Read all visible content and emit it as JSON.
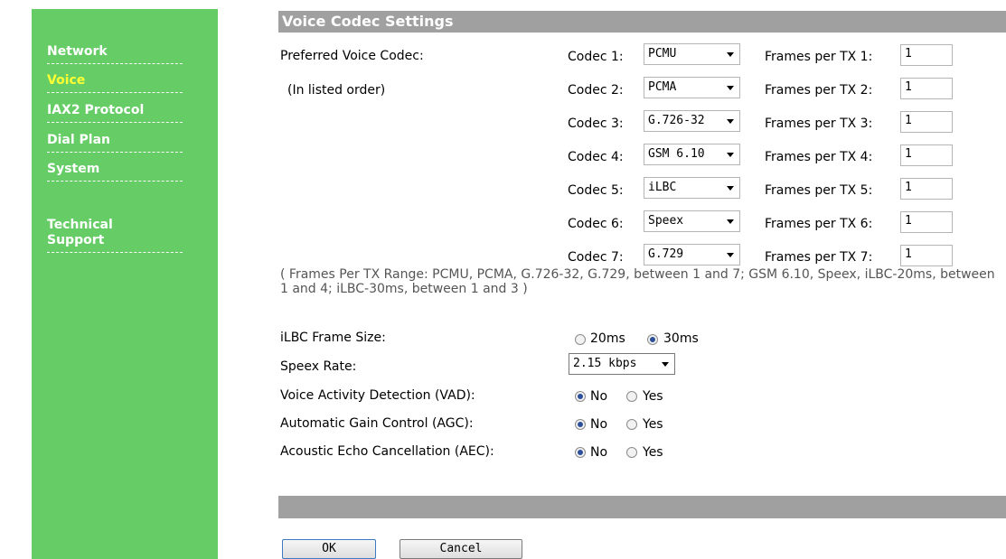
{
  "nav": {
    "items": [
      {
        "label": "Network"
      },
      {
        "label": "Voice"
      },
      {
        "label": "IAX2 Protocol"
      },
      {
        "label": "Dial Plan"
      },
      {
        "label": "System"
      }
    ],
    "support_line1": "Technical",
    "support_line2": "Support"
  },
  "section": {
    "title": "Voice Codec Settings"
  },
  "preferred": {
    "label": "Preferred Voice Codec:",
    "order_note": "(In listed order)"
  },
  "codecs": [
    {
      "label": "Codec 1:",
      "value": "PCMU",
      "frames_label": "Frames per TX 1:",
      "frames": "1"
    },
    {
      "label": "Codec 2:",
      "value": "PCMA",
      "frames_label": "Frames per TX 2:",
      "frames": "1"
    },
    {
      "label": "Codec 3:",
      "value": "G.726-32",
      "frames_label": "Frames per TX 3:",
      "frames": "1"
    },
    {
      "label": "Codec 4:",
      "value": "GSM 6.10",
      "frames_label": "Frames per TX 4:",
      "frames": "1"
    },
    {
      "label": "Codec 5:",
      "value": "iLBC",
      "frames_label": "Frames per TX 5:",
      "frames": "1"
    },
    {
      "label": "Codec 6:",
      "value": "Speex",
      "frames_label": "Frames per TX 6:",
      "frames": "1"
    },
    {
      "label": "Codec 7:",
      "value": "G.729",
      "frames_label": "Frames per TX 7:",
      "frames": "1"
    }
  ],
  "range_note": "( Frames Per TX Range: PCMU, PCMA, G.726-32, G.729, between 1 and 7; GSM 6.10, Speex, iLBC-20ms, between 1 and 4; iLBC-30ms, between 1 and 3 )",
  "ilbc": {
    "label": "iLBC Frame Size:",
    "opt1": "20ms",
    "opt2": "30ms",
    "selected": "30ms"
  },
  "speex": {
    "label": "Speex Rate:",
    "value": "2.15 kbps"
  },
  "vad": {
    "label": "Voice Activity Detection (VAD):",
    "no": "No",
    "yes": "Yes",
    "selected": "No"
  },
  "agc": {
    "label": "Automatic Gain Control (AGC):",
    "no": "No",
    "yes": "Yes",
    "selected": "No"
  },
  "aec": {
    "label": "Acoustic Echo Cancellation (AEC):",
    "no": "No",
    "yes": "Yes",
    "selected": "No"
  },
  "buttons": {
    "ok": "OK",
    "cancel": "Cancel"
  },
  "colors": {
    "sidebar": "#66cc66",
    "active_nav": "#ffff33",
    "header_bar": "#a0a0a0"
  }
}
